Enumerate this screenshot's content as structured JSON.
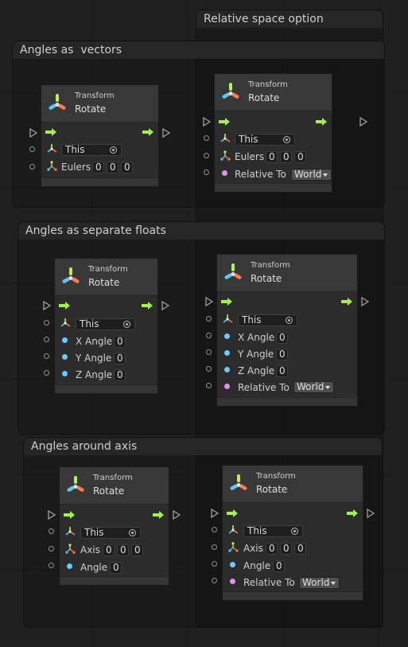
{
  "groups": {
    "relative": "Relative space option",
    "vectors": "Angles as  vectors",
    "floats": "Angles as separate floats",
    "axis": "Angles around axis"
  },
  "node": {
    "category": "Transform",
    "title": "Rotate"
  },
  "fields": {
    "this": "This",
    "eulers": "Eulers",
    "axis": "Axis",
    "angle": "Angle",
    "x_angle": "X Angle",
    "y_angle": "Y Angle",
    "z_angle": "Z Angle",
    "relative_to": "Relative To",
    "zero": "0",
    "world": "World"
  },
  "colors": {
    "flow": "#a4f04a",
    "float_port": "#6cc9ff",
    "enum_port": "#e58ef2"
  }
}
